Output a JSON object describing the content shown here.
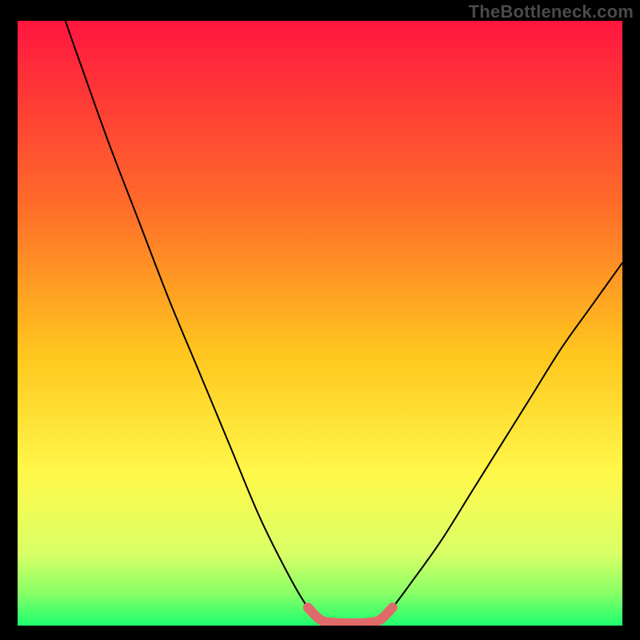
{
  "watermark": {
    "text": "TheBottleneck.com"
  },
  "colors": {
    "frame_bg": "#000000",
    "gradient_top": "#ff163f",
    "gradient_mid1": "#ff8a1e",
    "gradient_mid2": "#ffde2a",
    "gradient_mid3": "#f7ff59",
    "gradient_bottom": "#1cff6e",
    "curve": "#000000",
    "highlight": "#e06a6a"
  },
  "chart_data": {
    "type": "line",
    "title": "",
    "xlabel": "",
    "ylabel": "",
    "xlim": [
      0,
      100
    ],
    "ylim": [
      0,
      100
    ],
    "series": [
      {
        "name": "bottleneck-curve",
        "x": [
          0,
          5,
          10,
          15,
          20,
          25,
          30,
          35,
          40,
          45,
          48,
          50,
          52,
          55,
          58,
          60,
          62,
          65,
          70,
          75,
          80,
          85,
          90,
          95,
          100
        ],
        "y": [
          120,
          108,
          94,
          80,
          67,
          54,
          42,
          30,
          18,
          8,
          3,
          1,
          0.5,
          0.4,
          0.5,
          1,
          3,
          7,
          14,
          22,
          30,
          38,
          46,
          53,
          60
        ]
      }
    ],
    "highlight_segment": {
      "series": "bottleneck-curve",
      "x_start": 48,
      "x_end": 62,
      "stroke_width_pct": 1.6
    },
    "background_gradient": {
      "direction": "vertical",
      "stops": [
        {
          "offset": 0.0,
          "color": "#ff163f"
        },
        {
          "offset": 0.3,
          "color": "#ff6a2a"
        },
        {
          "offset": 0.55,
          "color": "#ffc61e"
        },
        {
          "offset": 0.75,
          "color": "#fff84a"
        },
        {
          "offset": 0.88,
          "color": "#d9ff66"
        },
        {
          "offset": 0.945,
          "color": "#8cff66"
        },
        {
          "offset": 1.0,
          "color": "#1cff6e"
        }
      ]
    }
  }
}
